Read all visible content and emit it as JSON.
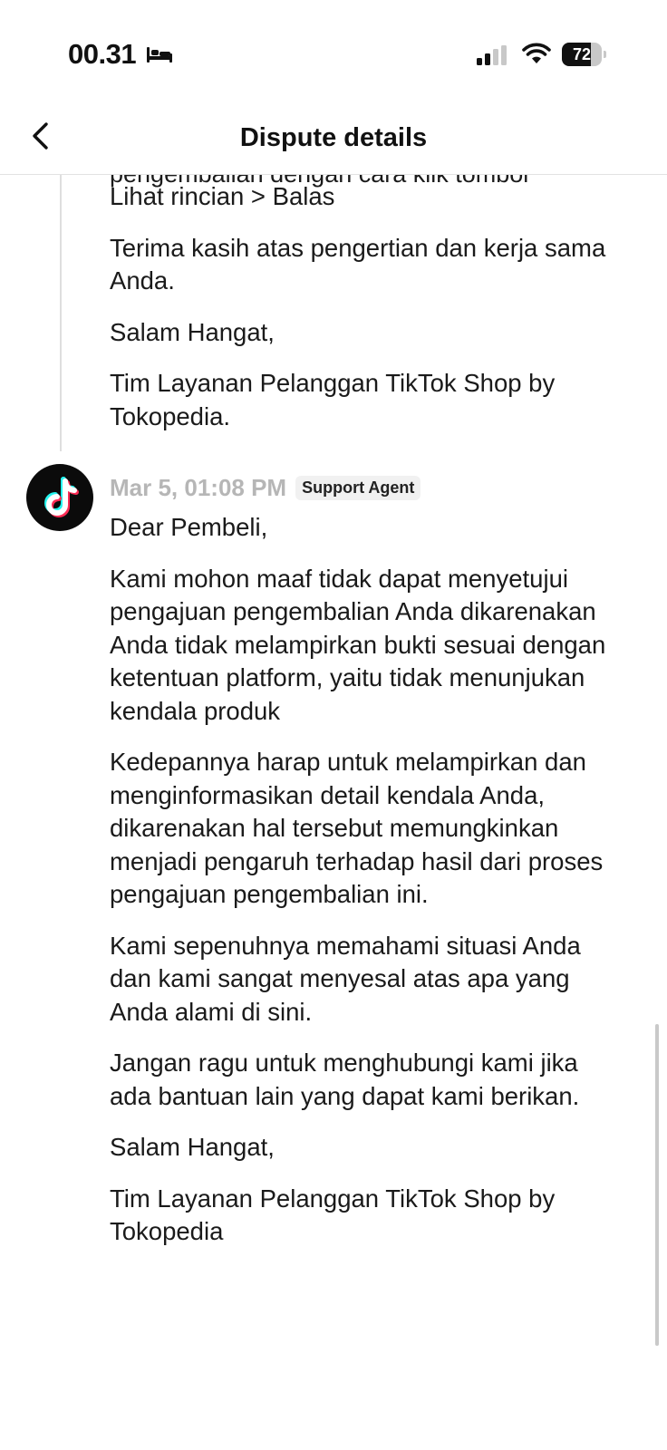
{
  "status_bar": {
    "time": "00.31",
    "battery": "72",
    "battery_level": 0.72,
    "icons": [
      "bed-icon",
      "cellular-signal-icon",
      "wifi-icon",
      "battery-icon"
    ]
  },
  "header": {
    "back_icon": "chevron-left-icon",
    "title": "Dispute details"
  },
  "thread": {
    "prev_message": {
      "partial_top_line": "pengembalian dengan cara klik tombol",
      "paragraphs": [
        "Lihat rincian > Balas",
        "Terima kasih atas pengertian dan kerja sama Anda.",
        "Salam Hangat,",
        "Tim Layanan Pelanggan TikTok Shop by Tokopedia."
      ]
    },
    "message": {
      "avatar_icon": "tiktok-logo-icon",
      "timestamp": "Mar 5, 01:08 PM",
      "role_badge": "Support Agent",
      "paragraphs": [
        "Dear Pembeli,",
        "Kami mohon maaf tidak dapat menyetujui pengajuan pengembalian Anda dikarenakan Anda tidak melampirkan bukti sesuai dengan ketentuan platform, yaitu tidak menunjukan kendala produk",
        "Kedepannya harap untuk melampirkan dan menginformasikan detail kendala Anda, dikarenakan hal tersebut memungkinkan menjadi pengaruh terhadap hasil dari proses pengajuan pengembalian ini.",
        "Kami sepenuhnya memahami situasi Anda dan kami sangat menyesal atas apa yang Anda alami di sini.",
        "Jangan ragu untuk menghubungi kami jika ada bantuan lain yang dapat kami berikan.",
        "Salam Hangat,",
        "Tim Layanan Pelanggan TikTok Shop by Tokopedia"
      ]
    }
  },
  "colors": {
    "text": "#1a1a1a",
    "timestamp": "#b6b6b6",
    "badge_bg": "#f1f1f1",
    "divider": "#e2e2e2",
    "tiktok_cyan": "#25f4ee",
    "tiktok_red": "#fe2c55"
  }
}
